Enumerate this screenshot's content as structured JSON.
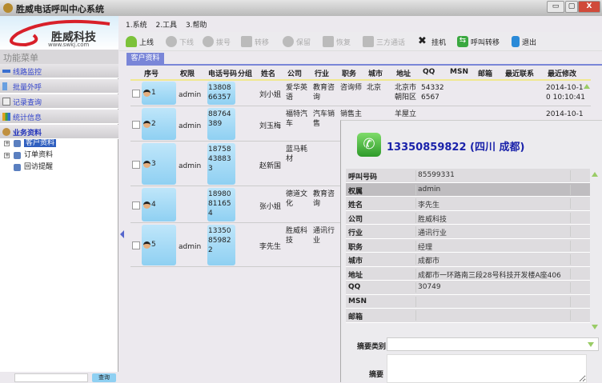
{
  "window": {
    "title": "胜威电话呼叫中心系统",
    "min": "▭",
    "max": "▢",
    "close": "X"
  },
  "logo": {
    "brand": "胜威科技",
    "url": "www.swkj.com"
  },
  "sidebar": {
    "header": "功能菜单",
    "items": [
      {
        "label": "线路监控"
      },
      {
        "label": "批量外呼"
      },
      {
        "label": "记录查询"
      },
      {
        "label": "统计信息"
      },
      {
        "label": "业务资料"
      }
    ],
    "tree": [
      {
        "label": "客户资料",
        "expand": "+"
      },
      {
        "label": "订单资料",
        "expand": "+"
      },
      {
        "label": "回访提醒"
      }
    ],
    "search_button": "查询"
  },
  "menubar": [
    "1.系统",
    "2.工具",
    "3.帮助"
  ],
  "toolbar": [
    {
      "label": "上线",
      "enabled": true
    },
    {
      "label": "下线",
      "enabled": false
    },
    {
      "label": "拨号",
      "enabled": false
    },
    {
      "label": "转移",
      "enabled": false
    },
    {
      "label": "保留",
      "enabled": false
    },
    {
      "label": "恢复",
      "enabled": false
    },
    {
      "label": "三方通话",
      "enabled": false
    },
    {
      "label": "挂机",
      "enabled": true
    },
    {
      "label": "呼叫转移",
      "enabled": true
    },
    {
      "label": "退出",
      "enabled": true
    }
  ],
  "tab": "客户资料",
  "table": {
    "columns": [
      "序号",
      "权限",
      "电话号码",
      "分组",
      "姓名",
      "公司",
      "行业",
      "职务",
      "城市",
      "地址",
      "QQ",
      "MSN",
      "邮箱",
      "最近联系",
      "最近修改"
    ],
    "rows": [
      {
        "seq": "1",
        "owner": "admin",
        "phone": "13808 66357",
        "name": "刘小姐",
        "company": "爱华英语",
        "industry": "教育咨询",
        "title": "咨询师",
        "city": "北京",
        "address": "北京市朝阳区",
        "qq": "54332 6567",
        "modified": "2014-10-1 0 10:10:41"
      },
      {
        "seq": "2",
        "owner": "admin",
        "phone": "88764 389",
        "name": "刘玉梅",
        "company": "福特汽车",
        "industry": "汽车销售",
        "title": "销售主",
        "city": "",
        "address": "羊屋立",
        "qq": "",
        "modified": "2014-10-1"
      },
      {
        "seq": "3",
        "owner": "admin",
        "phone": "18758 43883 3",
        "name": "赵新国",
        "company": "蓝马耗材",
        "industry": "",
        "title": "",
        "city": "",
        "address": "",
        "qq": "",
        "modified": ""
      },
      {
        "seq": "4",
        "owner": "",
        "phone": "18980 81165 4",
        "name": "张小姐",
        "company": "德道文化",
        "industry": "教育咨询",
        "title": "",
        "city": "",
        "address": "",
        "qq": "",
        "modified": ""
      },
      {
        "seq": "5",
        "owner": "admin",
        "phone": "13350 85982 2",
        "name": "李先生",
        "company": "胜威科技",
        "industry": "通讯行业",
        "title": "",
        "city": "",
        "address": "",
        "qq": "",
        "modified": ""
      }
    ]
  },
  "popup": {
    "caller": "13350859822 (四川 成都)",
    "details": [
      {
        "label": "呼叫号码",
        "value": "85599331"
      },
      {
        "label": "权属",
        "value": "admin"
      },
      {
        "label": "姓名",
        "value": "李先生"
      },
      {
        "label": "公司",
        "value": "胜威科技"
      },
      {
        "label": "行业",
        "value": "通讯行业"
      },
      {
        "label": "职务",
        "value": "经理"
      },
      {
        "label": "城市",
        "value": "成都市"
      },
      {
        "label": "地址",
        "value": "成都市一环路南三段28号科技开发楼A座406"
      },
      {
        "label": "QQ",
        "value": "30749"
      },
      {
        "label": "MSN",
        "value": ""
      },
      {
        "label": "邮箱",
        "value": ""
      }
    ],
    "summary_category_label": "摘要类别",
    "summary_label": "摘要"
  },
  "colors": {
    "accent": "#7a86d8",
    "link": "#3344cc",
    "caller": "#1a22aa"
  }
}
